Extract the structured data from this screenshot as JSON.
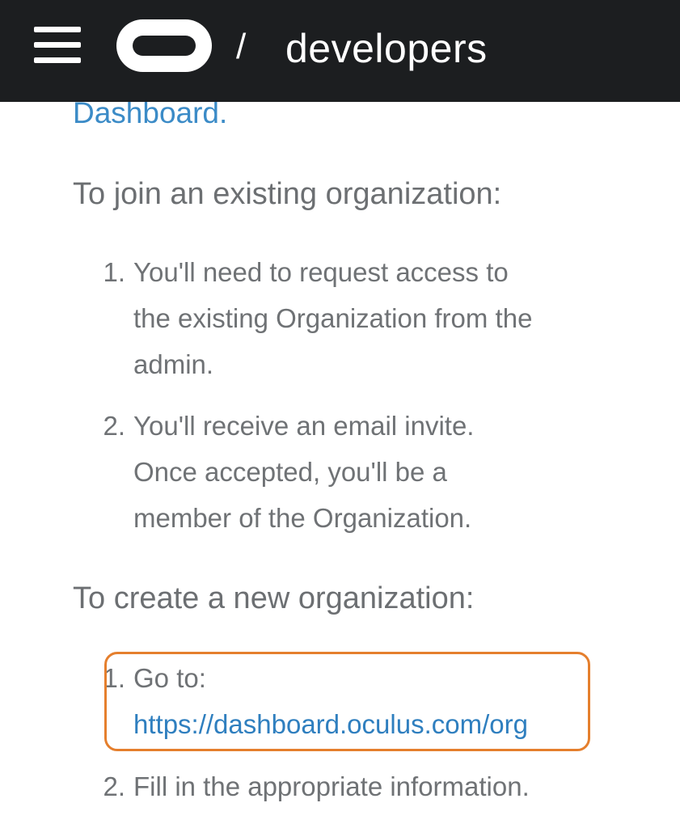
{
  "header": {
    "brand_separator": "/",
    "brand_name": "developers"
  },
  "content": {
    "dashboard_link": "Dashboard.",
    "join_heading": "To join an existing organization:",
    "join_steps": [
      {
        "number": "1.",
        "lines": [
          "You'll need to request access to",
          "the existing Organization from the",
          "admin."
        ]
      },
      {
        "number": "2.",
        "lines": [
          "You'll receive an email invite.",
          "Once accepted, you'll be a",
          "member of the Organization."
        ]
      }
    ],
    "create_heading": "To create a new organization:",
    "create_steps": [
      {
        "number": "1.",
        "text": "Go to:",
        "link": "https://dashboard.oculus.com/org"
      },
      {
        "number": "2.",
        "text": "Fill in the appropriate information."
      }
    ]
  },
  "colors": {
    "header_bg": "#1c1e20",
    "link": "#3b8bc7",
    "highlight_border": "#e57f2d"
  }
}
